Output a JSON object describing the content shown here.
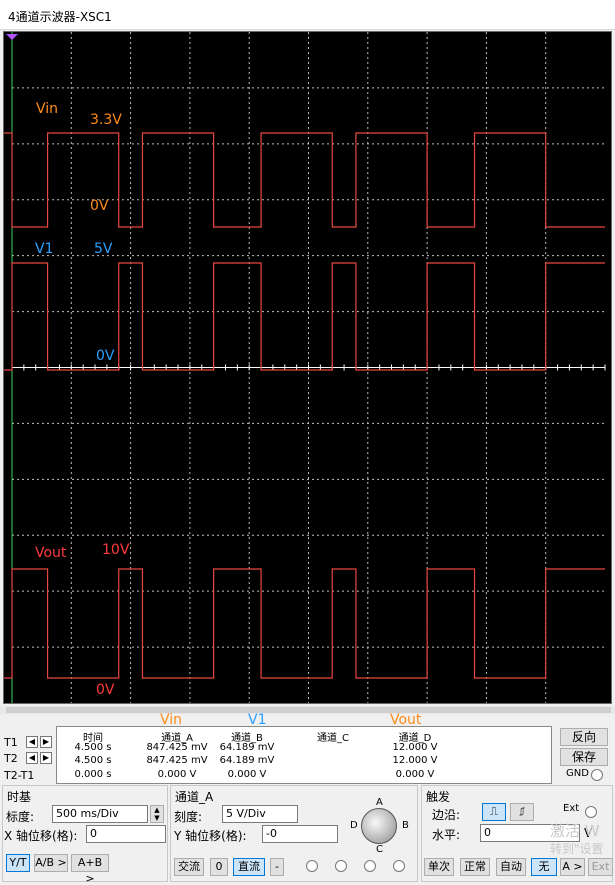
{
  "window": {
    "title": "4通道示波器-XSC1"
  },
  "scope": {
    "background": "#000000",
    "grid_color": "#bfbfbf",
    "trace_color": "#e8473f",
    "labels": {
      "vin": "Vin",
      "vin_high": "3.3V",
      "vin_low": "0V",
      "v1": "V1",
      "v1_high": "5V",
      "v1_low": "0V",
      "vout": "Vout",
      "vout_high": "10V",
      "vout_low": "0V"
    },
    "label_colors": {
      "orange": "#ff8c1a",
      "blue": "#2aa0ff",
      "red": "#ff3a3a"
    }
  },
  "readout": {
    "rows": [
      "T1",
      "T2",
      "T2-T1"
    ],
    "headers": [
      "时间",
      "通道_A",
      "通道_B",
      "通道_C",
      "通道_D"
    ],
    "values": [
      [
        "4.500 s",
        "847.425 mV",
        "64.189 mV",
        "",
        "12.000 V"
      ],
      [
        "4.500 s",
        "847.425 mV",
        "64.189 mV",
        "",
        "12.000 V"
      ],
      [
        "0.000 s",
        "0.000 V",
        "0.000 V",
        "",
        "0.000 V"
      ]
    ],
    "overlay": {
      "vin": "Vin",
      "v1": "V1",
      "vout": "Vout"
    },
    "reverse_button": "反向",
    "save_button": "保存",
    "gnd_label": "GND"
  },
  "timebase": {
    "title": "时基",
    "scale_label": "标度:",
    "scale_value": "500 ms/Div",
    "xpos_label": "X 轴位移(格):",
    "xpos_value": "0",
    "modes": [
      "Y/T",
      "A/B >",
      "A+B >"
    ]
  },
  "channel": {
    "title": "通道_A",
    "scale_label": "刻度:",
    "scale_value": "5  V/Div",
    "ypos_label": "Y 轴位移(格):",
    "ypos_value": "-0",
    "coupling": [
      "交流",
      "0",
      "直流",
      "-"
    ],
    "knob_labels": {
      "a": "A",
      "b": "B",
      "c": "C",
      "d": "D"
    }
  },
  "trigger": {
    "title": "触发",
    "edge_label": "边沿:",
    "ext_label": "Ext",
    "level_label": "水平:",
    "level_value": "0",
    "level_unit": "V",
    "modes": [
      "单次",
      "正常",
      "自动",
      "无",
      "A >",
      "Ext"
    ]
  },
  "watermark": {
    "line1": "激活 W",
    "line2": "转到\"设置"
  },
  "waveforms": {
    "x_breaks": [
      0,
      3,
      9,
      11,
      17,
      21,
      27,
      29,
      35,
      39,
      45
    ],
    "vin": {
      "high": 3.3,
      "low": 0
    },
    "v1": {
      "high": 5,
      "low": 0
    },
    "vout": {
      "high": 10,
      "low": 0
    }
  }
}
